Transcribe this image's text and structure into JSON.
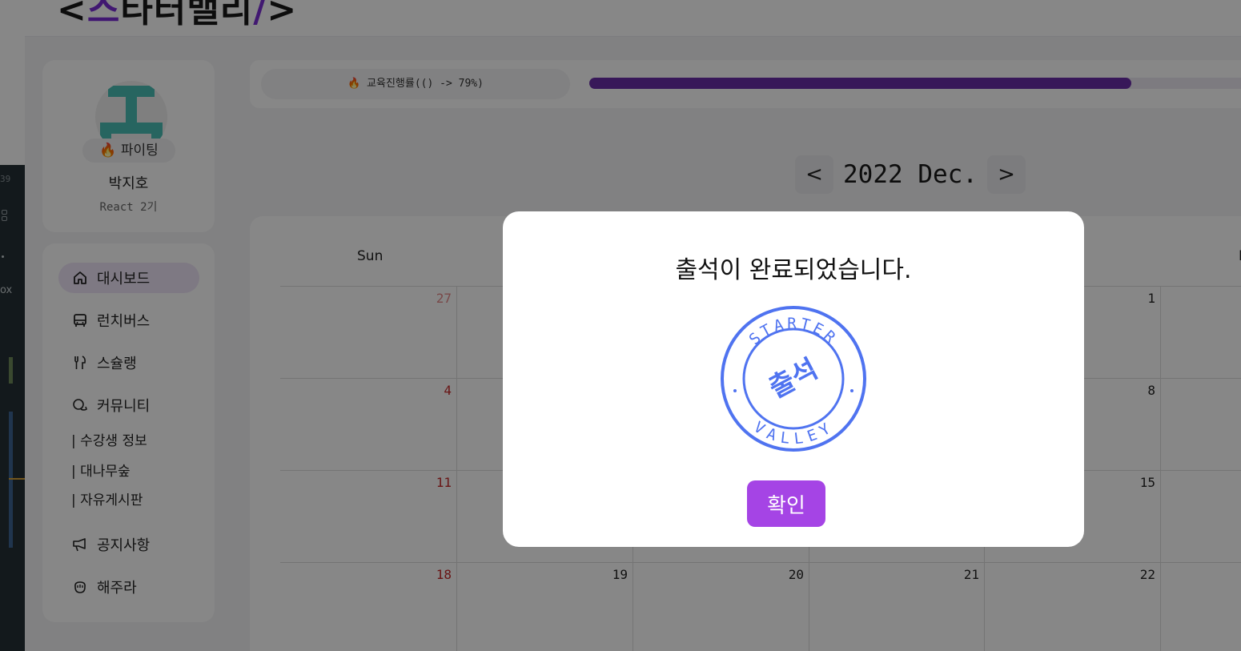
{
  "side_window": {
    "number": "39",
    "text": "ox"
  },
  "header": {
    "logo_prefix": "<",
    "logo_accent1": "스",
    "logo_main": "타터밸리",
    "logo_accent2": "/",
    "logo_suffix": ">"
  },
  "profile": {
    "badge_icon": "🔥",
    "badge_label": "파이팅",
    "name": "박지호",
    "class": "React 2기"
  },
  "nav": {
    "items": [
      {
        "icon": "home-icon",
        "label": "대시보드",
        "active": true
      },
      {
        "icon": "bus-icon",
        "label": "런치버스"
      },
      {
        "icon": "fork-knife-icon",
        "label": "스슐랭"
      },
      {
        "icon": "chat-icon",
        "label": "커뮤니티"
      }
    ],
    "sub_items": [
      "| 수강생 정보",
      "| 대나무숲",
      "| 자유게시판"
    ],
    "bottom_items": [
      {
        "icon": "megaphone-icon",
        "label": "공지사항"
      },
      {
        "icon": "hand-icon",
        "label": "해주라"
      }
    ]
  },
  "progress": {
    "label": "🔥 교육진행률(() -> 79%)",
    "percent": 79,
    "color": "#6a2fa8"
  },
  "calendar": {
    "month_label": "2022 Dec.",
    "prev": "<",
    "next": ">",
    "dow": [
      "Sun",
      "F"
    ],
    "rows": [
      [
        "27",
        "",
        "",
        "",
        "1"
      ],
      [
        "4",
        "",
        "",
        "",
        "8"
      ],
      [
        "11",
        "",
        "",
        "",
        "15"
      ],
      [
        "18",
        "19",
        "20",
        "21",
        "22"
      ]
    ]
  },
  "modal": {
    "title": "출석이 완료되었습니다.",
    "stamp_top": "STARTER",
    "stamp_bottom": "VALLEY",
    "stamp_center": "출석",
    "confirm_label": "확인",
    "accent": "#a544e5",
    "stamp_color": "#4f73f0"
  }
}
